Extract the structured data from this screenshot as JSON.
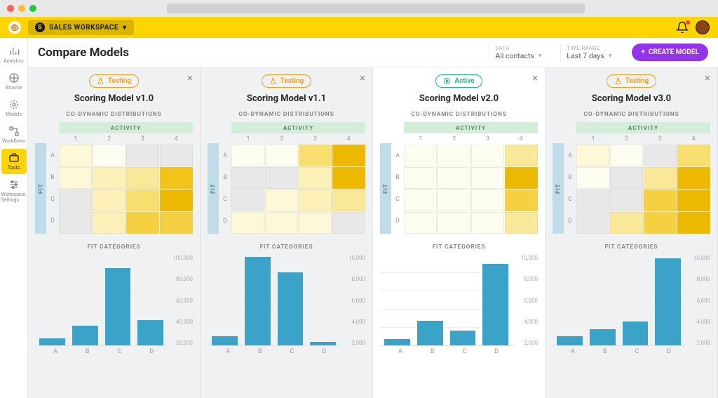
{
  "workspace": {
    "name": "SALES WORKSPACE"
  },
  "sidebar": {
    "items": [
      {
        "label": "Analytics",
        "key": "analytics"
      },
      {
        "label": "Browse",
        "key": "browse"
      },
      {
        "label": "Models",
        "key": "models"
      },
      {
        "label": "Workflows",
        "key": "workflows"
      },
      {
        "label": "Tools",
        "key": "tools",
        "active": true
      },
      {
        "label": "Workspace Settings",
        "key": "workspace-settings"
      }
    ]
  },
  "header": {
    "title": "Compare Models",
    "filters": {
      "data_label": "DATA",
      "data_value": "All contacts",
      "time_label": "TIME RANGE",
      "time_value": "Last 7 days"
    },
    "create_button": "CREATE MODEL"
  },
  "section_labels": {
    "codyn": "CO-DYNAMIC DISTRIBUTIONS",
    "activity": "ACTIVITY",
    "fit": "FIT",
    "fitcat": "FIT CATEGORIES"
  },
  "heatmap_axes": {
    "cols": [
      "1",
      "2",
      "3",
      "4"
    ],
    "rows": [
      "A",
      "B",
      "C",
      "D"
    ]
  },
  "bar_x": [
    "A",
    "B",
    "C",
    "D"
  ],
  "status_labels": {
    "testing": "Testing",
    "active": "Active"
  },
  "models": [
    {
      "title": "Scoring Model v1.0",
      "status": "testing"
    },
    {
      "title": "Scoring Model v1.1",
      "status": "testing"
    },
    {
      "title": "Scoring Model v2.0",
      "status": "active"
    },
    {
      "title": "Scoring Model v3.0",
      "status": "testing"
    }
  ],
  "chart_data": [
    {
      "heatmap": {
        "type": "heatmap",
        "rows": [
          "A",
          "B",
          "C",
          "D"
        ],
        "cols": [
          "1",
          "2",
          "3",
          "4"
        ],
        "values": [
          [
            0.15,
            0.08,
            0.1,
            0.12
          ],
          [
            0.15,
            0.2,
            0.35,
            0.7
          ],
          [
            0.1,
            0.25,
            0.5,
            1.0
          ],
          [
            0.12,
            0.2,
            0.55,
            0.6
          ]
        ],
        "colorscale": "yellow"
      },
      "bars": {
        "type": "bar",
        "categories": [
          "A",
          "B",
          "C",
          "D"
        ],
        "values": [
          8000,
          22000,
          85000,
          28000
        ],
        "ylabel": "",
        "ylim": [
          0,
          100000
        ],
        "yticks": [
          20000,
          40000,
          60000,
          80000,
          100000
        ],
        "ytick_labels": [
          "20,000",
          "40,000",
          "60,000",
          "80,000",
          "100,000"
        ]
      }
    },
    {
      "heatmap": {
        "type": "heatmap",
        "rows": [
          "A",
          "B",
          "C",
          "D"
        ],
        "cols": [
          "1",
          "2",
          "3",
          "4"
        ],
        "values": [
          [
            0.08,
            0.08,
            0.4,
            1.0
          ],
          [
            0.1,
            0.12,
            0.2,
            0.95
          ],
          [
            0.1,
            0.15,
            0.2,
            0.3
          ],
          [
            0.15,
            0.15,
            0.15,
            0.12
          ]
        ],
        "colorscale": "yellow"
      },
      "bars": {
        "type": "bar",
        "categories": [
          "A",
          "B",
          "C",
          "D"
        ],
        "values": [
          1000,
          9800,
          8100,
          400
        ],
        "ylabel": "",
        "ylim": [
          0,
          10000
        ],
        "yticks": [
          2000,
          4000,
          6000,
          8000,
          10000
        ],
        "ytick_labels": [
          "2,000",
          "4,000",
          "6,000",
          "8,000",
          "10,000"
        ]
      }
    },
    {
      "heatmap": {
        "type": "heatmap",
        "rows": [
          "A",
          "B",
          "C",
          "D"
        ],
        "cols": [
          "1",
          "2",
          "3",
          "4"
        ],
        "values": [
          [
            0.05,
            0.05,
            0.06,
            0.35
          ],
          [
            0.06,
            0.06,
            0.08,
            0.9
          ],
          [
            0.05,
            0.05,
            0.08,
            0.6
          ],
          [
            0.06,
            0.06,
            0.06,
            0.3
          ]
        ],
        "colorscale": "yellow"
      },
      "bars": {
        "type": "bar",
        "categories": [
          "A",
          "B",
          "C",
          "D"
        ],
        "values": [
          700,
          2700,
          1600,
          9000
        ],
        "ylabel": "",
        "ylim": [
          0,
          10000
        ],
        "yticks": [
          2000,
          4000,
          6000,
          8000,
          10000
        ],
        "ytick_labels": [
          "2,000",
          "4,000",
          "6,000",
          "8,000",
          "10,000"
        ]
      }
    },
    {
      "heatmap": {
        "type": "heatmap",
        "rows": [
          "A",
          "B",
          "C",
          "D"
        ],
        "cols": [
          "1",
          "2",
          "3",
          "4"
        ],
        "values": [
          [
            0.18,
            0.08,
            0.1,
            0.5
          ],
          [
            0.08,
            0.1,
            0.3,
            1.0
          ],
          [
            0.1,
            0.12,
            0.6,
            1.0
          ],
          [
            0.1,
            0.3,
            0.55,
            0.95
          ]
        ],
        "colorscale": "yellow"
      },
      "bars": {
        "type": "bar",
        "categories": [
          "A",
          "B",
          "C",
          "D"
        ],
        "values": [
          1000,
          1800,
          2600,
          9600
        ],
        "ylabel": "",
        "ylim": [
          0,
          10000
        ],
        "yticks": [
          2000,
          4000,
          6000,
          8000,
          10000
        ],
        "ytick_labels": [
          "2,000",
          "4,000",
          "6,000",
          "8,000",
          "10,000"
        ]
      }
    }
  ]
}
